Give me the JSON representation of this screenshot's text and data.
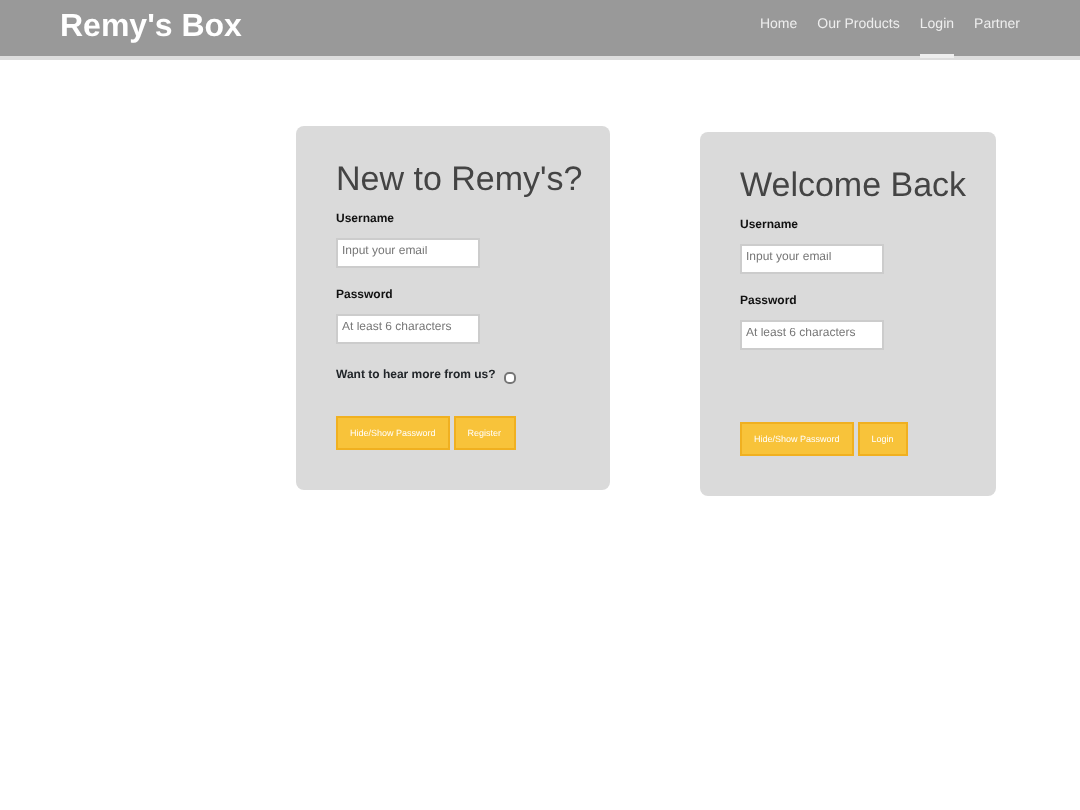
{
  "navbar": {
    "brand": "Remy's Box",
    "links": [
      {
        "label": "Home",
        "selected": false
      },
      {
        "label": "Our Products",
        "selected": false
      },
      {
        "label": "Login",
        "selected": true
      },
      {
        "label": "Partner",
        "selected": false
      }
    ]
  },
  "forms": [
    {
      "title": "New to Remy's?",
      "fields": [
        {
          "label": "Username",
          "placeholder": "Input your email"
        },
        {
          "label": "Password",
          "placeholder": "At least 6 characters"
        }
      ],
      "checkbox": {
        "label": "Want to hear more from us?",
        "checked": false
      },
      "buttons": [
        "Hide/Show Password",
        "Register"
      ]
    },
    {
      "title": "Welcome Back",
      "fields": [
        {
          "label": "Username",
          "placeholder": "Input your email"
        },
        {
          "label": "Password",
          "placeholder": "At least 6 characters"
        }
      ],
      "buttons": [
        "Hide/Show Password",
        "Login"
      ]
    }
  ]
}
